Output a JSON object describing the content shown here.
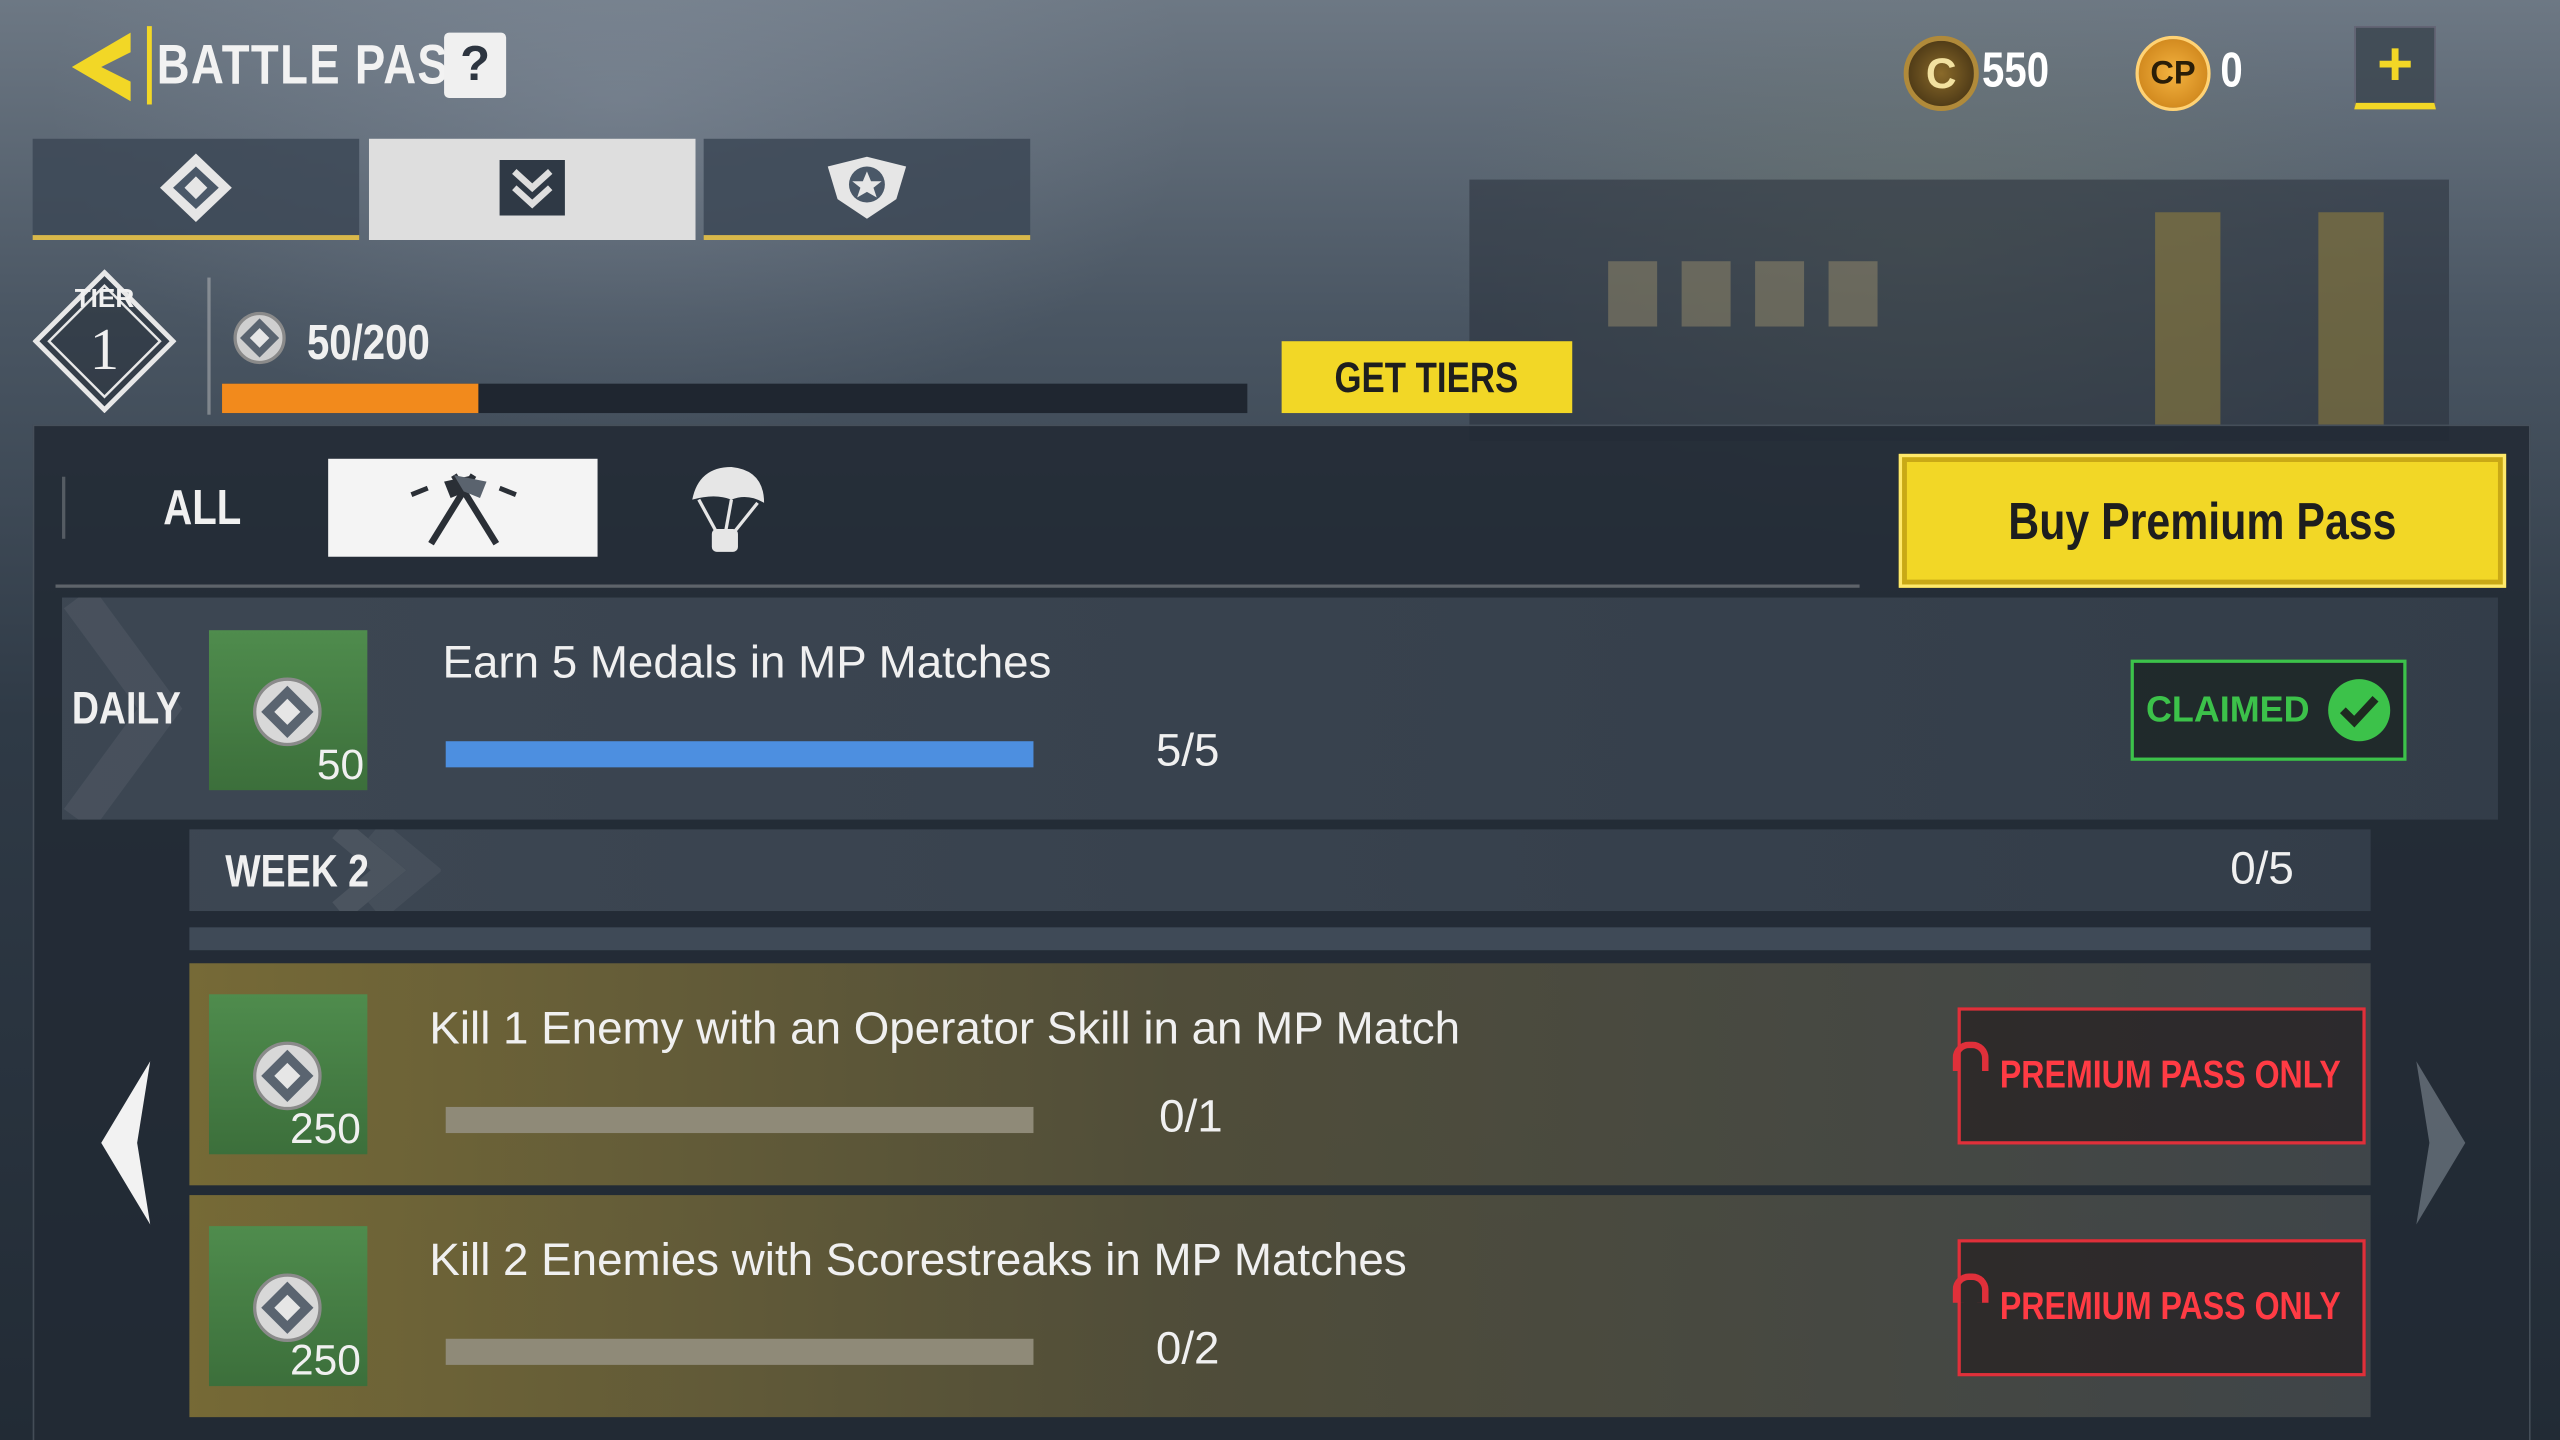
{
  "header": {
    "title": "BATTLE PASS",
    "help_label": "?",
    "cod_points_icon_letter": "C",
    "cod_points_value": "550",
    "credits_icon_letter": "CP",
    "credits_value": "0",
    "add_label": "+"
  },
  "top_tabs": [
    {
      "icon": "battle-pass-emblem-icon",
      "active": false
    },
    {
      "icon": "missions-chevron-icon",
      "active": true
    },
    {
      "icon": "premium-shield-icon",
      "active": false
    }
  ],
  "tier": {
    "label": "TIER",
    "number": "1",
    "xp_text": "50/200",
    "progress": 0.25,
    "get_tiers_label": "GET TIERS"
  },
  "filters": {
    "all_label": "ALL",
    "items": [
      {
        "icon": "multiplayer-flags-icon",
        "active": true
      },
      {
        "icon": "battle-royale-parachute-icon",
        "active": false
      }
    ]
  },
  "buy_premium_label": "Buy Premium Pass",
  "daily": {
    "label": "DAILY",
    "quest": "Earn 5 Medals in MP Matches",
    "reward": "50",
    "progress_text": "5/5",
    "progress": 1.0,
    "status": "CLAIMED"
  },
  "week": {
    "label": "WEEK 2",
    "progress_text": "0/5"
  },
  "quests": [
    {
      "text": "Kill 1 Enemy with an Operator Skill in an MP Match",
      "reward": "250",
      "progress_text": "0/1",
      "progress": 0,
      "lock_label": "PREMIUM PASS ONLY"
    },
    {
      "text": "Kill 2 Enemies with Scorestreaks in MP Matches",
      "reward": "250",
      "progress_text": "0/2",
      "progress": 0,
      "lock_label": "PREMIUM PASS ONLY"
    }
  ],
  "colors": {
    "accent_yellow": "#f2d726",
    "xp_orange": "#f28a1c",
    "progress_blue": "#4d8fe0",
    "claimed_green": "#3cc24a",
    "premium_red": "#e0303a"
  }
}
